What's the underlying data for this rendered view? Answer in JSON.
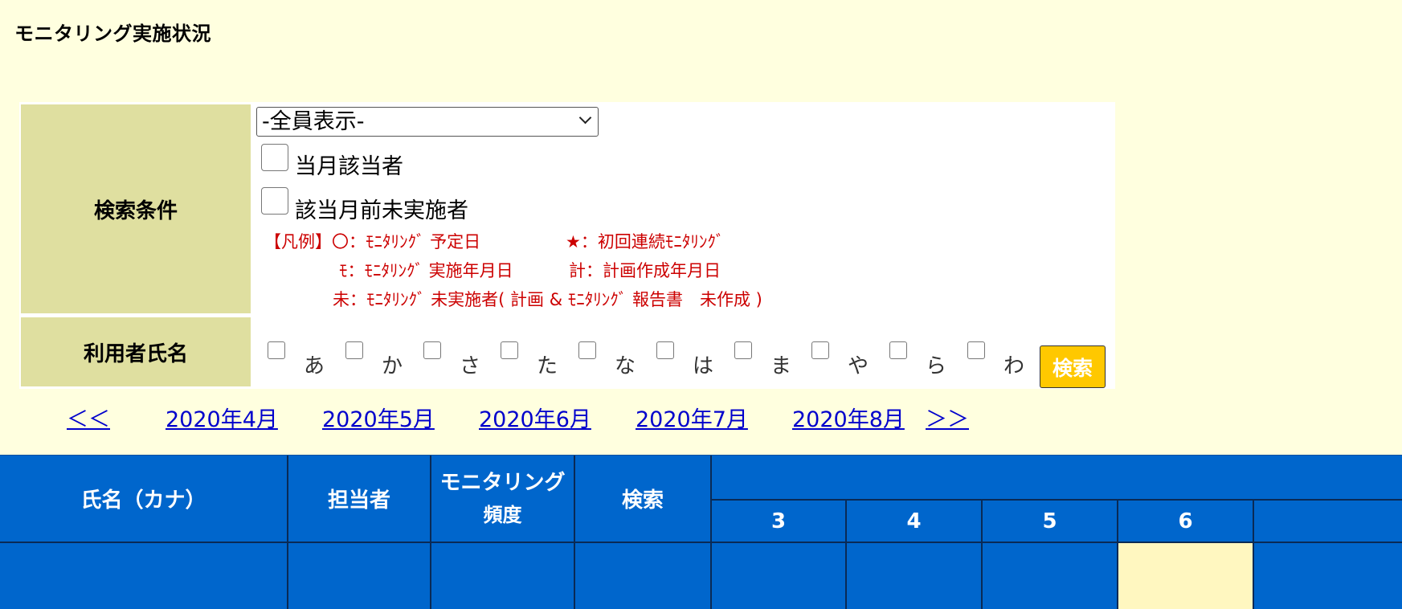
{
  "page": {
    "title": "モニタリング実施状況"
  },
  "search": {
    "condition_label": "検索条件",
    "select_value": "-全員表示-",
    "checkbox_current_month": "当月該当者",
    "checkbox_prev_unexecuted": "該当月前未実施者",
    "legend": {
      "line1a": "【凡例】〇：ﾓﾆﾀﾘﾝｸﾞ 予定日",
      "line1b": "★：初回連続ﾓﾆﾀﾘﾝｸﾞ",
      "line2a": "ﾓ：ﾓﾆﾀﾘﾝｸﾞ 実施年月日",
      "line2b": "計：計画作成年月日",
      "line3": "未：ﾓﾆﾀﾘﾝｸﾞ 未実施者( 計画 & ﾓﾆﾀﾘﾝｸﾞ 報告書　未作成 )"
    },
    "user_name_label": "利用者氏名",
    "kana": [
      "あ",
      "か",
      "さ",
      "た",
      "な",
      "は",
      "ま",
      "や",
      "ら",
      "わ"
    ],
    "search_button": "検索"
  },
  "month_nav": {
    "prev": "＜＜",
    "months": [
      "2020年4月",
      "2020年5月",
      "2020年6月",
      "2020年7月",
      "2020年8月"
    ],
    "next": "＞＞"
  },
  "table": {
    "headers": {
      "name": "氏名（カナ）",
      "staff": "担当者",
      "frequency_line1": "モニタリング",
      "frequency_line2": "頻度",
      "search": "検索"
    },
    "days": [
      "3",
      "4",
      "5",
      "6"
    ]
  },
  "colors": {
    "page_bg": "#ffffdf",
    "label_bg": "#dfdfa0",
    "header_bg": "#0066cc",
    "legend_red": "#cc0000",
    "link_blue": "#0000cc",
    "button_yellow": "#ffc800"
  }
}
